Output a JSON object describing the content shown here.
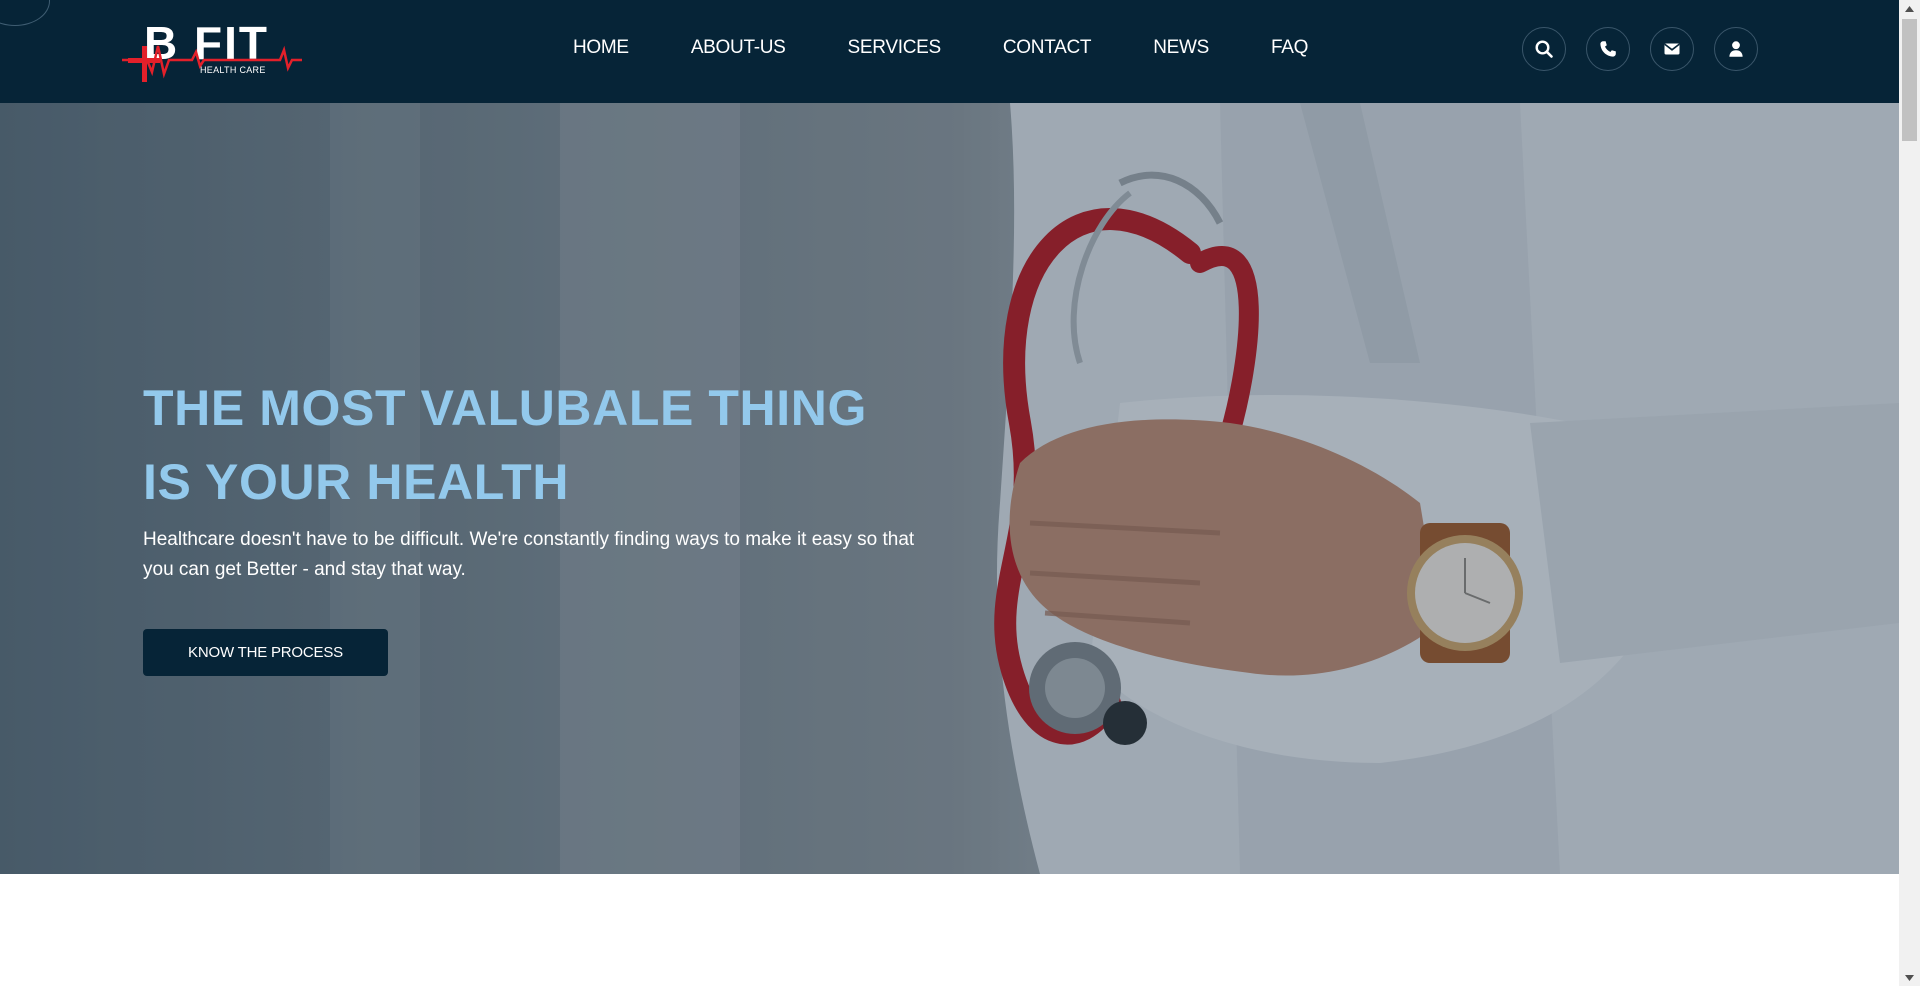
{
  "header": {
    "logo": {
      "brand": "B FIT",
      "tagline": "HEALTH CARE"
    },
    "nav": [
      {
        "label": "HOME"
      },
      {
        "label": "ABOUT-US"
      },
      {
        "label": "SERVICES"
      },
      {
        "label": "CONTACT"
      },
      {
        "label": "NEWS"
      },
      {
        "label": "FAQ"
      }
    ],
    "icons": [
      "search-icon",
      "phone-icon",
      "envelope-icon",
      "user-icon"
    ]
  },
  "hero": {
    "title_line1": "THE MOST VALUBALE THING",
    "title_line2": "IS YOUR HEALTH",
    "subtitle": "Healthcare doesn't have to be difficult. We're constantly finding ways to make it easy so that you can get Better - and stay that way.",
    "button_label": "KNOW THE PROCESS",
    "image": "doctor-with-stethoscope-photo"
  },
  "colors": {
    "header_bg": "#062437",
    "accent_title": "#93c9ec",
    "button_bg": "#062437",
    "logo_red": "#e3202a"
  }
}
